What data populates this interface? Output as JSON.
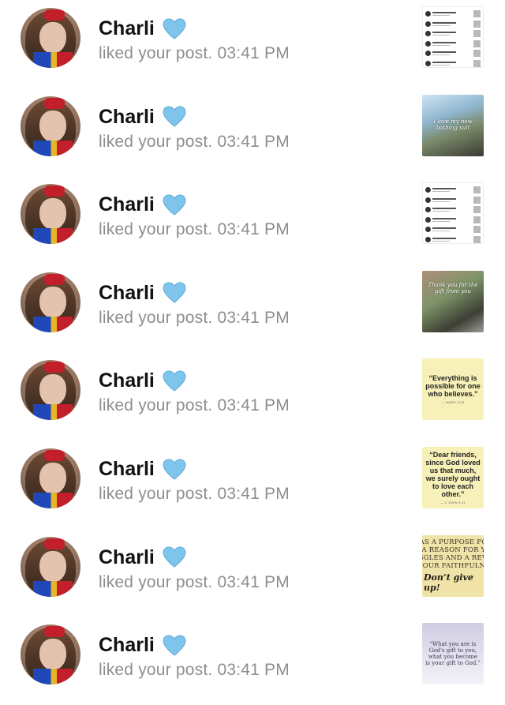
{
  "notifications": [
    {
      "user": "Charli",
      "emoji": "💙",
      "action": "liked your post.",
      "time": "03:41 PM",
      "thumbnail": {
        "kind": "list"
      }
    },
    {
      "user": "Charli",
      "emoji": "💙",
      "action": "liked your post.",
      "time": "03:41 PM",
      "thumbnail": {
        "kind": "photo-beach",
        "caption": "I love my new bathing suit"
      }
    },
    {
      "user": "Charli",
      "emoji": "💙",
      "action": "liked your post.",
      "time": "03:41 PM",
      "thumbnail": {
        "kind": "list"
      }
    },
    {
      "user": "Charli",
      "emoji": "💙",
      "action": "liked your post.",
      "time": "03:41 PM",
      "thumbnail": {
        "kind": "photo-garden",
        "caption": "Thank you for the gift from you"
      }
    },
    {
      "user": "Charli",
      "emoji": "💙",
      "action": "liked your post.",
      "time": "03:41 PM",
      "thumbnail": {
        "kind": "quote",
        "text": "“Everything is possible for one who believes.”",
        "ref": "— MARK 9:23"
      }
    },
    {
      "user": "Charli",
      "emoji": "💙",
      "action": "liked your post.",
      "time": "03:41 PM",
      "thumbnail": {
        "kind": "quote",
        "text": "“Dear friends, since God loved us that much, we surely ought to love each other.”",
        "ref": "— 1 JOHN 4:11"
      }
    },
    {
      "user": "Charli",
      "emoji": "💙",
      "action": "liked your post.",
      "time": "03:41 PM",
      "thumbnail": {
        "kind": "vintage",
        "lines": [
          "HAS A PURPOSE FOR",
          "IN, A REASON FOR YOU",
          "UGGLES AND A REWA",
          "R YOUR FAITHFULNES"
        ],
        "emphasis": "Don’t give up!"
      }
    },
    {
      "user": "Charli",
      "emoji": "💙",
      "action": "liked your post.",
      "time": "03:41 PM",
      "thumbnail": {
        "kind": "lavender",
        "text": "\"What you are is God's gift to you, what you become is your gift to God.\""
      }
    }
  ],
  "colors": {
    "heart": "#7fc4ec",
    "secondary_text": "#8e8e8e",
    "primary_text": "#111111"
  }
}
